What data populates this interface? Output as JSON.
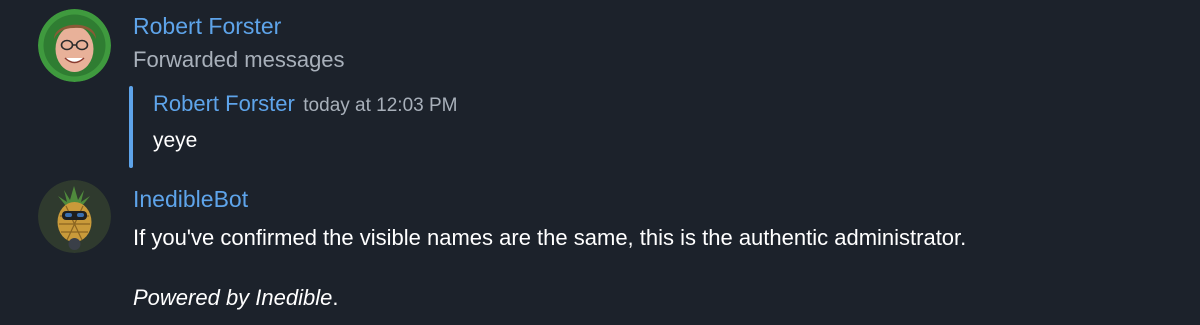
{
  "messages": [
    {
      "sender": "Robert Forster",
      "avatar_icon": "person-avatar-icon",
      "subtitle": "Forwarded messages",
      "forwarded": {
        "sender": "Robert Forster",
        "time": "today at 12:03 PM",
        "text": "yeye"
      }
    },
    {
      "sender": "InedibleBot",
      "avatar_icon": "pineapple-bot-avatar-icon",
      "text": "If you've confirmed the visible names are the same, this is the authentic administrator.",
      "footer": "Powered by Inedible",
      "footer_end": "."
    }
  ],
  "colors": {
    "background": "#1c222b",
    "name": "#5ea4ea",
    "muted": "#a8b0ba",
    "text": "#ffffff"
  }
}
